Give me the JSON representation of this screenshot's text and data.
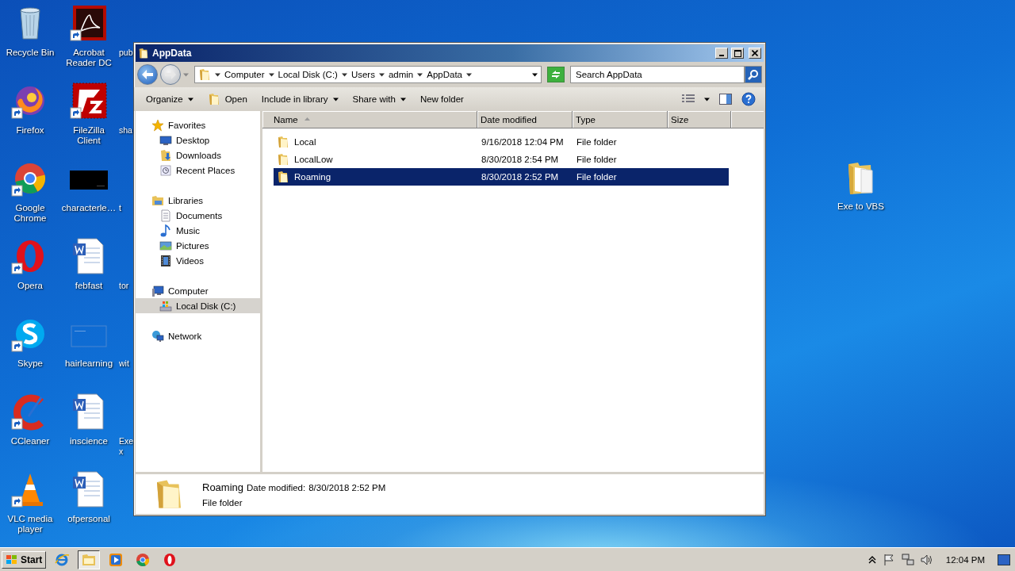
{
  "desktop": {
    "icons": [
      {
        "label": "Recycle Bin",
        "kind": "recycle",
        "shortcut": false
      },
      {
        "label": "Firefox",
        "kind": "firefox",
        "shortcut": true
      },
      {
        "label": "Google Chrome",
        "kind": "chrome",
        "shortcut": true
      },
      {
        "label": "Opera",
        "kind": "opera",
        "shortcut": true
      },
      {
        "label": "Skype",
        "kind": "skype",
        "shortcut": true
      },
      {
        "label": "CCleaner",
        "kind": "ccleaner",
        "shortcut": true
      },
      {
        "label": "VLC media player",
        "kind": "vlc",
        "shortcut": true
      },
      {
        "label": "Acrobat Reader DC",
        "kind": "acrobat",
        "shortcut": true
      },
      {
        "label": "FileZilla Client",
        "kind": "filezilla",
        "shortcut": true
      },
      {
        "label": "characterle…",
        "kind": "dark",
        "shortcut": false
      },
      {
        "label": "febfast",
        "kind": "word",
        "shortcut": false
      },
      {
        "label": "hairlearning",
        "kind": "blank",
        "shortcut": false
      },
      {
        "label": "inscience",
        "kind": "word",
        "shortcut": false
      },
      {
        "label": "ofpersonal",
        "kind": "word",
        "shortcut": false
      },
      {
        "label": "pub",
        "kind": "cut"
      },
      {
        "label": "sha",
        "kind": "cut"
      },
      {
        "label": "t",
        "kind": "cut"
      },
      {
        "label": "tor",
        "kind": "cut"
      },
      {
        "label": "wit",
        "kind": "cut"
      },
      {
        "label": "Exe\nx",
        "kind": "cut"
      }
    ],
    "loose_icon": {
      "label": "Exe to VBS",
      "kind": "folder",
      "shortcut": false
    }
  },
  "window": {
    "title": "AppData",
    "breadcrumbs": [
      "Computer",
      "Local Disk (C:)",
      "Users",
      "admin",
      "AppData"
    ],
    "search": {
      "placeholder": "Search AppData"
    },
    "commands": [
      {
        "label": "Organize",
        "dropdown": true,
        "icon": false
      },
      {
        "label": "Open",
        "dropdown": false,
        "icon": true
      },
      {
        "label": "Include in library",
        "dropdown": true,
        "icon": false
      },
      {
        "label": "Share with",
        "dropdown": true,
        "icon": false
      },
      {
        "label": "New folder",
        "dropdown": false,
        "icon": false
      }
    ],
    "nav": [
      {
        "label": "Favorites",
        "kind": "star",
        "selected": false,
        "children": [
          {
            "label": "Desktop",
            "kind": "desktop",
            "selected": false
          },
          {
            "label": "Downloads",
            "kind": "downloads",
            "selected": false
          },
          {
            "label": "Recent Places",
            "kind": "recent",
            "selected": false
          }
        ]
      },
      {
        "label": "Libraries",
        "kind": "libraries",
        "selected": false,
        "children": [
          {
            "label": "Documents",
            "kind": "documents",
            "selected": false
          },
          {
            "label": "Music",
            "kind": "music",
            "selected": false
          },
          {
            "label": "Pictures",
            "kind": "pictures",
            "selected": false
          },
          {
            "label": "Videos",
            "kind": "videos",
            "selected": false
          }
        ]
      },
      {
        "label": "Computer",
        "kind": "computer",
        "selected": false,
        "children": [
          {
            "label": "Local Disk (C:)",
            "kind": "disk",
            "selected": true
          }
        ]
      },
      {
        "label": "Network",
        "kind": "network",
        "selected": false
      }
    ],
    "columns": [
      {
        "label": "Name",
        "sorted": true
      },
      {
        "label": "Date modified",
        "sorted": false
      },
      {
        "label": "Type",
        "sorted": false
      },
      {
        "label": "Size",
        "sorted": false
      }
    ],
    "rows": [
      {
        "name": "Local",
        "date": "9/16/2018 12:04 PM",
        "type": "File folder",
        "selected": false
      },
      {
        "name": "LocalLow",
        "date": "8/30/2018 2:54 PM",
        "type": "File folder",
        "selected": false
      },
      {
        "name": "Roaming",
        "date": "8/30/2018 2:52 PM",
        "type": "File folder",
        "selected": true
      }
    ],
    "details": {
      "name": "Roaming",
      "label": "Date modified:",
      "value": "8/30/2018 2:52 PM",
      "type": "File folder"
    }
  },
  "taskbar": {
    "start": "Start",
    "apps": [
      {
        "kind": "ie",
        "active": false
      },
      {
        "kind": "explorer",
        "active": true
      },
      {
        "kind": "media",
        "active": false
      },
      {
        "kind": "chrome",
        "active": false
      },
      {
        "kind": "opera",
        "active": false
      }
    ],
    "clock": "12:04 PM"
  }
}
